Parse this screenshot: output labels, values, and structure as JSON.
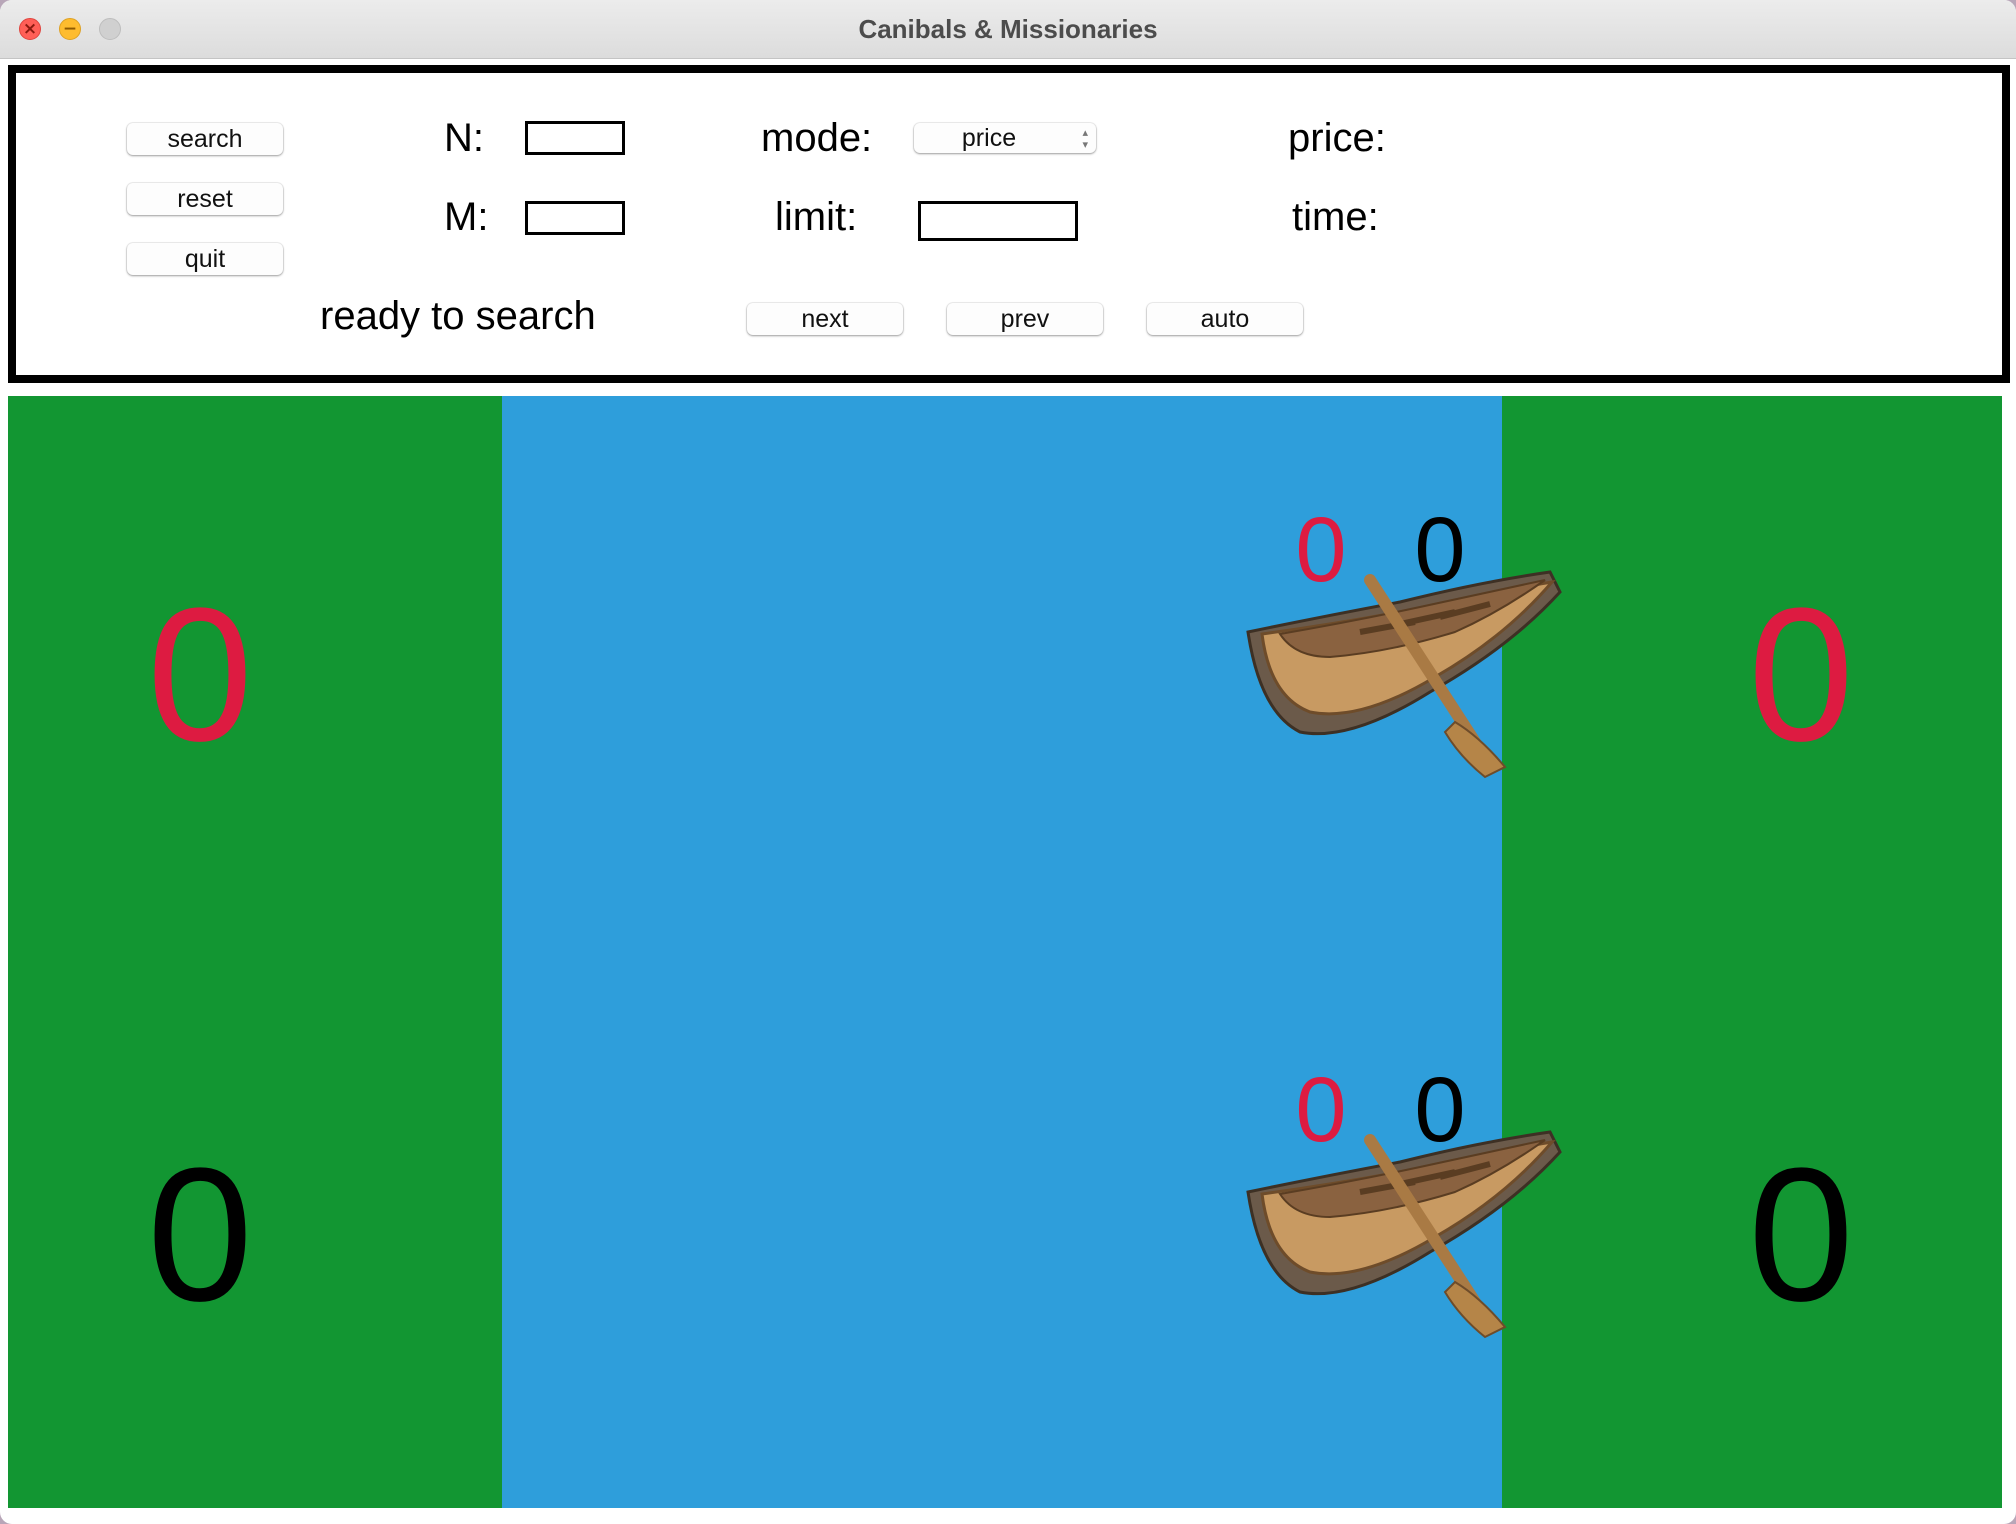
{
  "window": {
    "title": "Canibals & Missionaries",
    "controls": [
      "close",
      "minimize",
      "zoom"
    ]
  },
  "controls": {
    "buttons": {
      "search": "search",
      "reset": "reset",
      "quit": "quit",
      "next": "next",
      "prev": "prev",
      "auto": "auto"
    },
    "labels": {
      "n": "N:",
      "m": "M:",
      "mode": "mode:",
      "limit": "limit:",
      "price": "price:",
      "time": "time:"
    },
    "inputs": {
      "n_value": "",
      "m_value": "",
      "limit_value": ""
    },
    "mode_select": {
      "selected": "price"
    },
    "status": "ready to search"
  },
  "scene": {
    "colors": {
      "bank": "#129632",
      "river": "#2e9edb",
      "cannibal_count": "#dd1b41",
      "missionary_count": "#000000"
    },
    "left_bank": {
      "cannibals": "0",
      "missionaries": "0"
    },
    "right_bank": {
      "cannibals": "0",
      "missionaries": "0"
    },
    "boats": [
      {
        "cannibals": "0",
        "missionaries": "0",
        "icon": "rowboat-icon"
      },
      {
        "cannibals": "0",
        "missionaries": "0",
        "icon": "rowboat-icon"
      }
    ]
  }
}
